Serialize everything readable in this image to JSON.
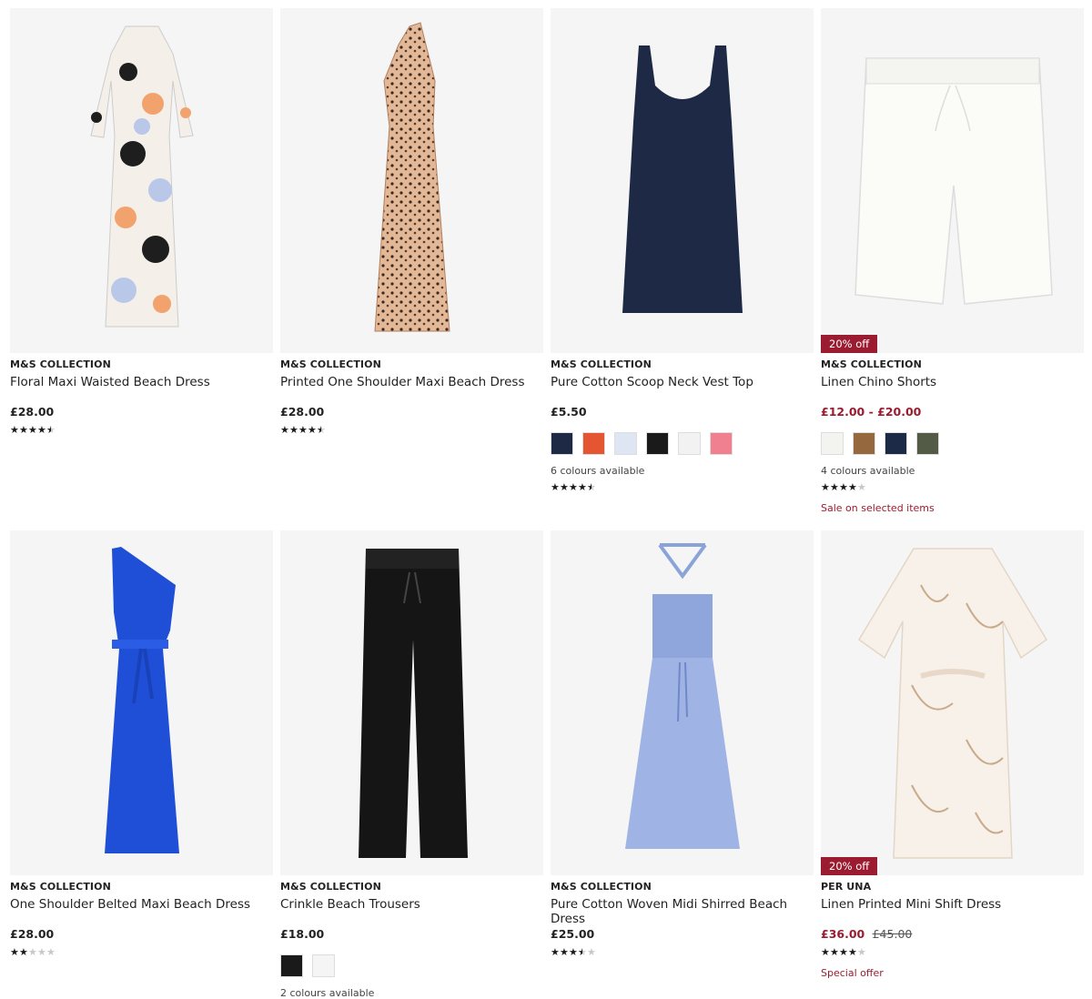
{
  "products": [
    {
      "brand": "M&S COLLECTION",
      "title": "Floral Maxi Waisted Beach Dress",
      "price": "£28.00",
      "rating": 4.5,
      "image_icon": "floral-maxi-dress"
    },
    {
      "brand": "M&S COLLECTION",
      "title": "Printed One Shoulder Maxi Beach Dress",
      "price": "£28.00",
      "rating": 4.5,
      "image_icon": "leopard-maxi-dress"
    },
    {
      "brand": "M&S COLLECTION",
      "title": "Pure Cotton Scoop Neck Vest Top",
      "price": "£5.50",
      "rating": 4.5,
      "colours_text": "6 colours available",
      "swatches": [
        "#1e2a45",
        "#e65532",
        "#dde6f2",
        "#1a1a1a",
        "#f2f2f2",
        "#f08090"
      ],
      "image_icon": "navy-vest-top"
    },
    {
      "brand": "M&S COLLECTION",
      "title": "Linen Chino Shorts",
      "badge": "20% off",
      "price_sale": "£12.00 - £20.00",
      "rating": 4,
      "colours_text": "4 colours available",
      "swatches": [
        "#f3f3f0",
        "#96683e",
        "#1d2a47",
        "#535a45"
      ],
      "note": "Sale on selected items",
      "image_icon": "white-linen-shorts"
    },
    {
      "brand": "M&S COLLECTION",
      "title": "One Shoulder Belted Maxi Beach Dress",
      "price": "£28.00",
      "rating": 2,
      "image_icon": "blue-maxi-dress"
    },
    {
      "brand": "M&S COLLECTION",
      "title": "Crinkle Beach Trousers",
      "price": "£18.00",
      "colours_text": "2 colours available",
      "swatches": [
        "#1a1a1a",
        "#f5f5f5"
      ],
      "image_icon": "black-trousers"
    },
    {
      "brand": "M&S COLLECTION",
      "title": "Pure Cotton Woven Midi Shirred Beach Dress",
      "price": "£25.00",
      "rating": 3.5,
      "image_icon": "blue-shirred-dress"
    },
    {
      "brand": "PER UNA",
      "title": "Linen Printed Mini Shift Dress",
      "badge": "20% off",
      "price_sale": "£36.00",
      "price_was": "£45.00",
      "rating": 4,
      "note": "Special offer",
      "image_icon": "printed-shift-dress"
    }
  ],
  "colors": {
    "sale_red": "#9b1c31",
    "image_bg": "#f5f5f5"
  }
}
